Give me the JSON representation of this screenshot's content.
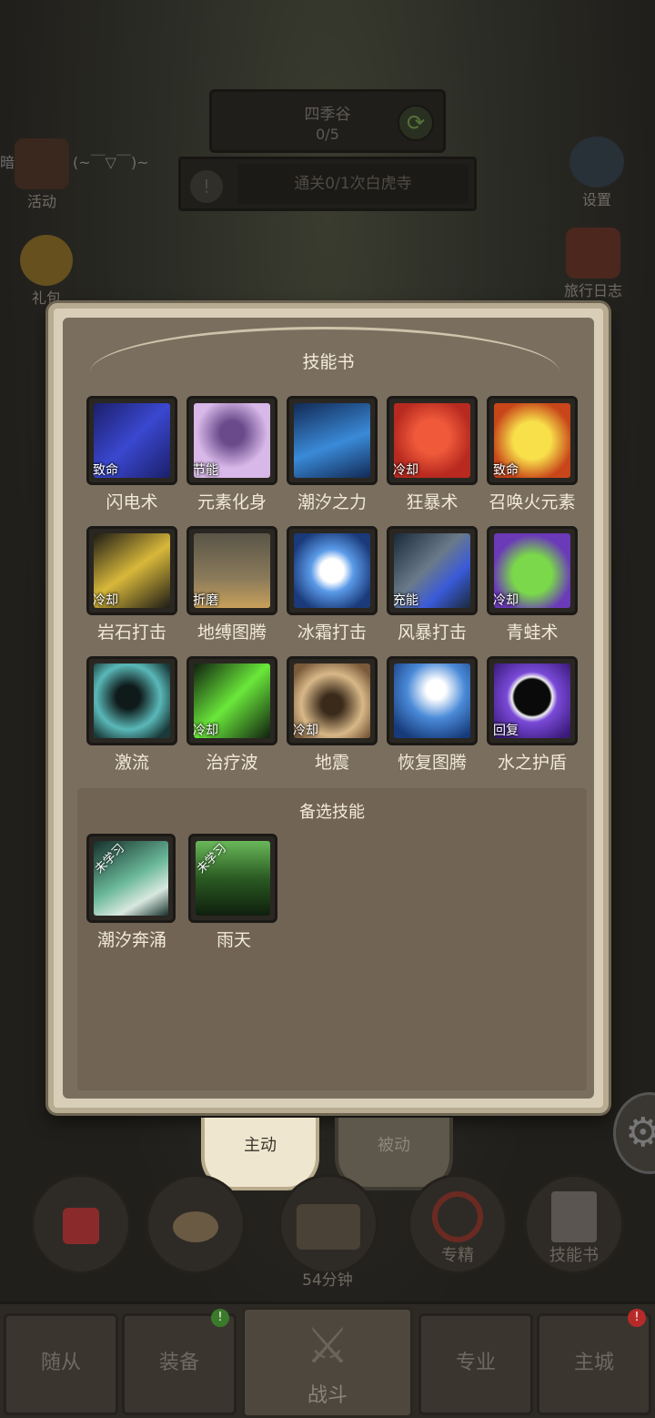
{
  "hud": {
    "stage_name": "四季谷",
    "stage_progress": "0/5",
    "quest_text": "通关0/1次白虎寺",
    "chat_text": "暗小湿大：(~￣▽￣)~",
    "left_icons": [
      {
        "label": "活动"
      },
      {
        "label": "礼包"
      }
    ],
    "right_icons": [
      {
        "label": "设置"
      },
      {
        "label": "旅行日志"
      }
    ]
  },
  "panel": {
    "title": "技能书",
    "skills": [
      {
        "name": "闪电术",
        "tag": "致命",
        "icon": "lightning-icon",
        "color": "#2c36a8"
      },
      {
        "name": "元素化身",
        "tag": "节能",
        "icon": "elemental-avatar-icon",
        "color": "#c9a8d8"
      },
      {
        "name": "潮汐之力",
        "tag": "",
        "icon": "tide-icon",
        "color": "#1e3f7a"
      },
      {
        "name": "狂暴术",
        "tag": "冷却",
        "icon": "rage-mask-icon",
        "color": "#c8352a"
      },
      {
        "name": "召唤火元素",
        "tag": "致命",
        "icon": "fire-elemental-icon",
        "color": "#e8c22a"
      },
      {
        "name": "岩石打击",
        "tag": "冷却",
        "icon": "rock-strike-icon",
        "color": "#2b2820"
      },
      {
        "name": "地缚图腾",
        "tag": "折磨",
        "icon": "earthbind-totem-icon",
        "color": "#6b6557"
      },
      {
        "name": "冰霜打击",
        "tag": "",
        "icon": "frost-strike-icon",
        "color": "#2a5aa8"
      },
      {
        "name": "风暴打击",
        "tag": "充能",
        "icon": "storm-strike-icon",
        "color": "#2b3f58"
      },
      {
        "name": "青蛙术",
        "tag": "冷却",
        "icon": "frog-icon",
        "color": "#7a3fbf"
      },
      {
        "name": "激流",
        "tag": "",
        "icon": "riptide-icon",
        "color": "#2c5f5f"
      },
      {
        "name": "治疗波",
        "tag": "冷却",
        "icon": "healing-wave-icon",
        "color": "#1f3d24"
      },
      {
        "name": "地震",
        "tag": "冷却",
        "icon": "earthquake-icon",
        "color": "#a8865a"
      },
      {
        "name": "恢复图腾",
        "tag": "",
        "icon": "healing-totem-icon",
        "color": "#1e4a8a"
      },
      {
        "name": "水之护盾",
        "tag": "回复",
        "icon": "water-shield-icon",
        "color": "#5a3a9a"
      }
    ],
    "alt_title": "备选技能",
    "alt_skills": [
      {
        "name": "潮汐奔涌",
        "ribbon": "未学习",
        "icon": "tidal-surge-icon",
        "color": "#2f5a48"
      },
      {
        "name": "雨天",
        "ribbon": "未学习",
        "icon": "rain-icon",
        "color": "#2c4a26"
      }
    ]
  },
  "tabs": {
    "active": "主动",
    "inactive": "被动"
  },
  "tools": {
    "timer": "54分钟",
    "specialization": "专精",
    "skillbook": "技能书"
  },
  "nav": {
    "followers": "随从",
    "equipment": "装备",
    "battle": "战斗",
    "profession": "专业",
    "main_city": "主城",
    "badge_equipment": "!",
    "badge_main_city": "!"
  }
}
